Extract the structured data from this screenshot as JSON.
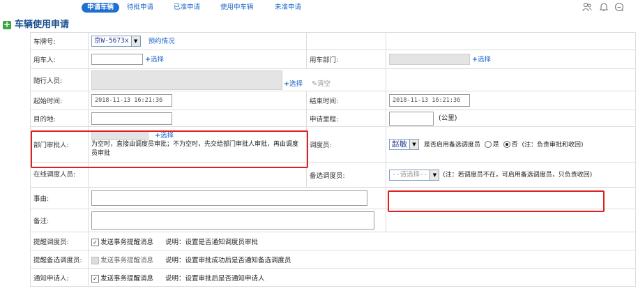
{
  "nav": {
    "tabs": [
      {
        "label": "申请车辆",
        "active": true
      },
      {
        "label": "待批申请",
        "active": false
      },
      {
        "label": "已准申请",
        "active": false
      },
      {
        "label": "使用中车辆",
        "active": false
      },
      {
        "label": "未准申请",
        "active": false
      }
    ],
    "icons": [
      "person-icon",
      "bell-icon",
      "chat-icon"
    ]
  },
  "page": {
    "title": "车辆使用申请"
  },
  "form": {
    "plate": {
      "label": "车牌号:",
      "value": "京W-5673x",
      "link": "预约情况"
    },
    "user": {
      "label": "用车人:",
      "value": "",
      "select": "选择"
    },
    "dept": {
      "label": "用车部门:",
      "value": "",
      "select": "选择"
    },
    "companions": {
      "label": "随行人员:",
      "select": "选择",
      "clear": "清空"
    },
    "start": {
      "label": "起始时间:",
      "value": "2018-11-13 16:21:36"
    },
    "end": {
      "label": "结束时间:",
      "value": "2018-11-13 16:21:36"
    },
    "destination": {
      "label": "目的地:",
      "value": ""
    },
    "mileage": {
      "label": "申请里程:",
      "value": "",
      "unit": "(公里)"
    },
    "dept_approver": {
      "label": "部门审批人:",
      "select": "选择",
      "note": "为空时，直接由调度员审批；不为空时，先交给部门审批人审批，再由调度员审批"
    },
    "dispatcher": {
      "label": "调度员:",
      "value": "赵敏",
      "enable_text": "是否启用备选调度员",
      "yes": "是",
      "no": "否",
      "note": "(注：负责审批和收回)",
      "enabled": false
    },
    "online": {
      "label": "在线调度人员:"
    },
    "backup": {
      "label": "备选调度员:",
      "value": "--请选择--",
      "note": "(注：若调度员不在，可启用备选调度员，只负责收回)"
    },
    "reason": {
      "label": "事由:",
      "value": ""
    },
    "remark": {
      "label": "备注:",
      "value": ""
    },
    "notify_dispatcher": {
      "label": "提醒调度员:",
      "checkbox": "发送事务提醒消息",
      "checked": true,
      "desc": "说明：设置是否通知调度员审批"
    },
    "notify_backup": {
      "label": "提醒备选调度员:",
      "checkbox": "发送事务提醒消息",
      "checked": false,
      "desc": "说明：设置审批成功后是否通知备选调度员"
    },
    "notify_applicant": {
      "label": "通知申请人:",
      "checkbox": "发送事务提醒消息",
      "checked": true,
      "desc": "说明：设置审批后是否通知申请人"
    }
  },
  "colors": {
    "accent": "#1f6fd0",
    "highlight": "#e02020",
    "title": "#1a4f8f"
  }
}
